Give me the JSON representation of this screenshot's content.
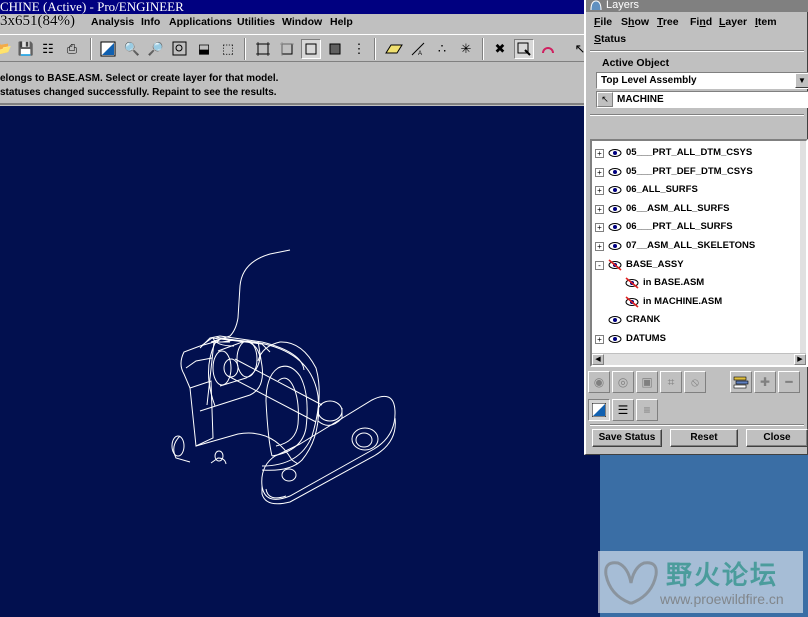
{
  "main_window": {
    "title": "CHINE (Active) - Pro/ENGINEER",
    "window_size_readout": "3x651(84%)",
    "menus": [
      "Analysis",
      "Info",
      "Applications",
      "Utilities",
      "Window",
      "Help"
    ],
    "messages": [
      "elongs to BASE.ASM. Select or create layer for that model.",
      "statuses changed successfully. Repaint to see the results."
    ],
    "toolbar_icons": [
      "open-icon",
      "save-icon",
      "save-copy-icon",
      "print-icon",
      "repaint-icon",
      "zoom-in-icon",
      "zoom-out-icon",
      "refit-icon",
      "orient-icon",
      "saved-views-icon",
      "wireframe-icon",
      "hidden-line-icon",
      "no-hidden-icon",
      "shading-icon",
      "model-tree-icon",
      "datum-planes-icon",
      "datum-axes-icon",
      "datum-points-icon",
      "coord-sys-icon",
      "spin-center-icon",
      "query-select-icon",
      "context-help-icon",
      "select-arrow-icon"
    ],
    "viewport_background": "#02104f"
  },
  "layers_dialog": {
    "title": "Layers",
    "menus": [
      {
        "label": "File",
        "u": "F"
      },
      {
        "label": "Show",
        "u": "h"
      },
      {
        "label": "Tree",
        "u": "T"
      },
      {
        "label": "Find",
        "u": "n"
      },
      {
        "label": "Layer",
        "u": "L"
      },
      {
        "label": "Item",
        "u": "I"
      },
      {
        "label": "Status",
        "u": "S"
      }
    ],
    "active_object_label": "Active Object",
    "active_object_select": "Top Level Assembly",
    "active_object_value": "MACHINE",
    "tree_rows": [
      {
        "label": "05___PRT_ALL_DTM_CSYS",
        "expander": "+",
        "indent": 0,
        "hidden": false
      },
      {
        "label": "05___PRT_DEF_DTM_CSYS",
        "expander": "+",
        "indent": 0,
        "hidden": false
      },
      {
        "label": "06_ALL_SURFS",
        "expander": "+",
        "indent": 0,
        "hidden": false
      },
      {
        "label": "06__ASM_ALL_SURFS",
        "expander": "+",
        "indent": 0,
        "hidden": false
      },
      {
        "label": "06___PRT_ALL_SURFS",
        "expander": "+",
        "indent": 0,
        "hidden": false
      },
      {
        "label": "07__ASM_ALL_SKELETONS",
        "expander": "+",
        "indent": 0,
        "hidden": false
      },
      {
        "label": "BASE_ASSY",
        "expander": "-",
        "indent": 0,
        "hidden": true
      },
      {
        "label": "in BASE.ASM",
        "expander": "",
        "indent": 1,
        "hidden": true
      },
      {
        "label": "in MACHINE.ASM",
        "expander": "",
        "indent": 1,
        "hidden": true
      },
      {
        "label": "CRANK",
        "expander": "",
        "indent": 0,
        "hidden": false
      },
      {
        "label": "DATUMS",
        "expander": "+",
        "indent": 0,
        "hidden": false
      }
    ],
    "buttons": {
      "save_status": "Save Status",
      "reset": "Reset",
      "close": "Close"
    }
  },
  "watermark": {
    "text": "野火论坛",
    "url": "www.proewildfire.cn"
  }
}
